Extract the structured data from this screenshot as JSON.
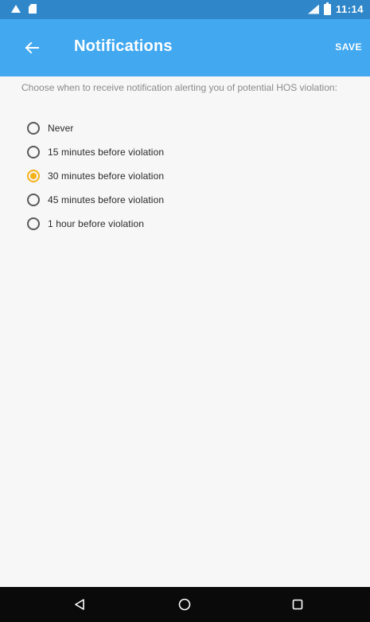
{
  "status_bar": {
    "time": "11:14",
    "icons": [
      "warning-icon",
      "sd-card-icon",
      "signal-icon",
      "battery-icon"
    ]
  },
  "app_bar": {
    "title": "Notifications",
    "save_label": "SAVE",
    "back_icon": "back-arrow-icon"
  },
  "prompt": "Choose when to receive notification alerting you of potential HOS violation:",
  "options": [
    {
      "label": "Never",
      "checked": false
    },
    {
      "label": "15 minutes before violation",
      "checked": false
    },
    {
      "label": "30 minutes before violation",
      "checked": true
    },
    {
      "label": "45 minutes before violation",
      "checked": false
    },
    {
      "label": "1 hour before violation",
      "checked": false
    }
  ],
  "nav_bar": {
    "icons": [
      "nav-back-icon",
      "nav-home-icon",
      "nav-recents-icon"
    ]
  },
  "colors": {
    "status_bar": "#2f86c8",
    "app_bar": "#42a8ef",
    "accent": "#f5b21a",
    "nav_bar": "#0a0a0a"
  }
}
